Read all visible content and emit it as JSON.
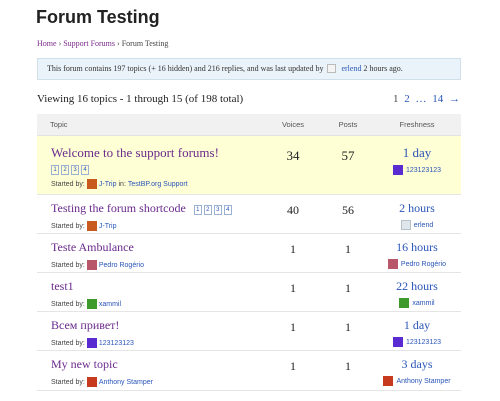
{
  "page": {
    "title": "Forum Testing"
  },
  "breadcrumb": {
    "home": "Home",
    "sep1": "›",
    "parent": "Support Forums",
    "sep2": "›",
    "current": "Forum Testing"
  },
  "info": {
    "text": "This forum contains 197 topics (+ 16 hidden) and 216 replies, and was last updated by",
    "user": "erlend",
    "time": "2 hours ago."
  },
  "listing": {
    "viewing": "Viewing 16 topics - 1 through 15 (of 198 total)",
    "pager": [
      "1",
      "2",
      "…",
      "14",
      "→"
    ]
  },
  "table": {
    "columns": [
      "Topic",
      "Voices",
      "Posts",
      "Freshness"
    ],
    "rows": [
      {
        "title": "Welcome to the support forums!",
        "pages": [
          "1",
          "2",
          "3",
          "4"
        ],
        "starter_label": "Started by:",
        "starter": "J-Trip",
        "in_label": "in:",
        "in_forum": "TestBP.org Support",
        "voices": "34",
        "posts": "57",
        "freshness": "1 day",
        "last_by": "123123123",
        "avatar_color": "#5a2bd0",
        "fresh_avatar_color": "#5a2bd0",
        "starter_avatar_color": "#c85a1e"
      },
      {
        "title": "Testing the forum shortcode",
        "pages": [
          "1",
          "2",
          "3",
          "4"
        ],
        "starter_label": "Started by:",
        "starter": "J-Trip",
        "voices": "40",
        "posts": "56",
        "freshness": "2 hours",
        "last_by": "erlend",
        "starter_avatar_color": "#c85a1e",
        "fresh_avatar_color": "#dfe6ec"
      },
      {
        "title": "Teste Ambulance",
        "starter_label": "Started by:",
        "starter": "Pedro Rogério",
        "voices": "1",
        "posts": "1",
        "freshness": "16 hours",
        "last_by": "Pedro Rogério",
        "starter_avatar_color": "#b8566a",
        "fresh_avatar_color": "#b8566a"
      },
      {
        "title": "test1",
        "starter_label": "Started by:",
        "starter": "xammil",
        "voices": "1",
        "posts": "1",
        "freshness": "22 hours",
        "last_by": "xammil",
        "starter_avatar_color": "#3f9a2c",
        "fresh_avatar_color": "#3f9a2c"
      },
      {
        "title": "Всем привет!",
        "starter_label": "Started by:",
        "starter": "123123123",
        "voices": "1",
        "posts": "1",
        "freshness": "1 day",
        "last_by": "123123123",
        "starter_avatar_color": "#5a2bd0",
        "fresh_avatar_color": "#5a2bd0"
      },
      {
        "title": "My new topic",
        "starter_label": "Started by:",
        "starter": "Anthony Stamper",
        "voices": "1",
        "posts": "1",
        "freshness": "3 days",
        "last_by": "Anthony Stamper",
        "starter_avatar_color": "#c83a1e",
        "fresh_avatar_color": "#c83a1e"
      }
    ]
  }
}
